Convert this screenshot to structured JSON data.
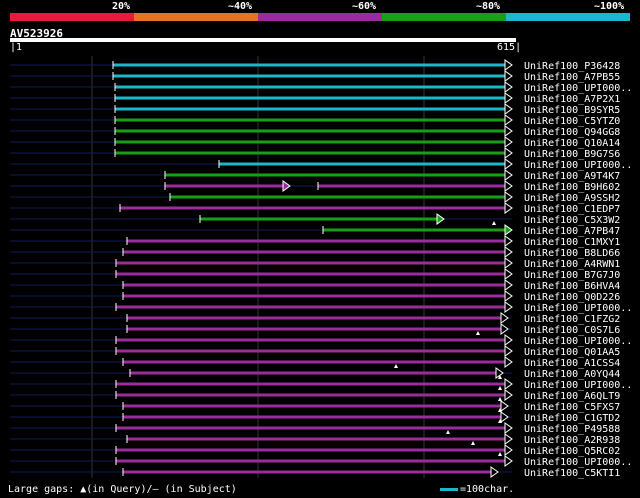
{
  "scale_labels": [
    "20%",
    "~40%",
    "~60%",
    "~80%",
    "~100%"
  ],
  "scale_colors": [
    "#e8193c",
    "#e8731e",
    "#9b2d9b",
    "#16a016",
    "#1ab8c8"
  ],
  "query": {
    "name": "AV523926",
    "start": "1",
    "end": "615"
  },
  "hits": [
    {
      "name": "UniRef100_P36428",
      "color": "#1ab8c8"
    },
    {
      "name": "UniRef100_A7PB55",
      "color": "#1ab8c8"
    },
    {
      "name": "UniRef100_UPI000..",
      "color": "#1ab8c8"
    },
    {
      "name": "UniRef100_A7P2X1",
      "color": "#1ab8c8"
    },
    {
      "name": "UniRef100_B9SYR5",
      "color": "#1ab8c8"
    },
    {
      "name": "UniRef100_C5YTZ0",
      "color": "#16a016"
    },
    {
      "name": "UniRef100_Q94GG8",
      "color": "#16a016"
    },
    {
      "name": "UniRef100_Q10A14",
      "color": "#16a016"
    },
    {
      "name": "UniRef100_B9G7S6",
      "color": "#16a016"
    },
    {
      "name": "UniRef100_UPI000..",
      "color": "#1ab8c8"
    },
    {
      "name": "UniRef100_A9T4K7",
      "color": "#16a016"
    },
    {
      "name": "UniRef100_B9H602",
      "color": "#9b2d9b"
    },
    {
      "name": "UniRef100_A9SSH2",
      "color": "#16a016"
    },
    {
      "name": "UniRef100_C1EDP7",
      "color": "#9b2d9b"
    },
    {
      "name": "UniRef100_C5X3W2",
      "color": "#16a016"
    },
    {
      "name": "UniRef100_A7PB47",
      "color": "#16a016"
    },
    {
      "name": "UniRef100_C1MXY1",
      "color": "#9b2d9b"
    },
    {
      "name": "UniRef100_B8LD66",
      "color": "#9b2d9b"
    },
    {
      "name": "UniRef100_A4RWN1",
      "color": "#9b2d9b"
    },
    {
      "name": "UniRef100_B7G7J0",
      "color": "#9b2d9b"
    },
    {
      "name": "UniRef100_B6HVA4",
      "color": "#9b2d9b"
    },
    {
      "name": "UniRef100_Q0D226",
      "color": "#9b2d9b"
    },
    {
      "name": "UniRef100_UPI000..",
      "color": "#9b2d9b"
    },
    {
      "name": "UniRef100_C1FZG2",
      "color": "#9b2d9b"
    },
    {
      "name": "UniRef100_C0S7L6",
      "color": "#9b2d9b"
    },
    {
      "name": "UniRef100_UPI000..",
      "color": "#9b2d9b"
    },
    {
      "name": "UniRef100_Q01AA5",
      "color": "#9b2d9b"
    },
    {
      "name": "UniRef100_A1CSS4",
      "color": "#9b2d9b"
    },
    {
      "name": "UniRef100_A0YQ44",
      "color": "#9b2d9b"
    },
    {
      "name": "UniRef100_UPI000..",
      "color": "#9b2d9b"
    },
    {
      "name": "UniRef100_A6QLT9",
      "color": "#9b2d9b"
    },
    {
      "name": "UniRef100_C5FXS7",
      "color": "#9b2d9b"
    },
    {
      "name": "UniRef100_C1GTD2",
      "color": "#9b2d9b"
    },
    {
      "name": "UniRef100_P49588",
      "color": "#9b2d9b"
    },
    {
      "name": "UniRef100_A2R938",
      "color": "#9b2d9b"
    },
    {
      "name": "UniRef100_Q5RC02",
      "color": "#9b2d9b"
    },
    {
      "name": "UniRef100_UPI000..",
      "color": "#9b2d9b"
    },
    {
      "name": "UniRef100_C5KTI1",
      "color": "#9b2d9b"
    }
  ],
  "footer": {
    "text": "Large gaps: ▲(in Query)/— (in Subject)",
    "scale_key": "=100char."
  }
}
